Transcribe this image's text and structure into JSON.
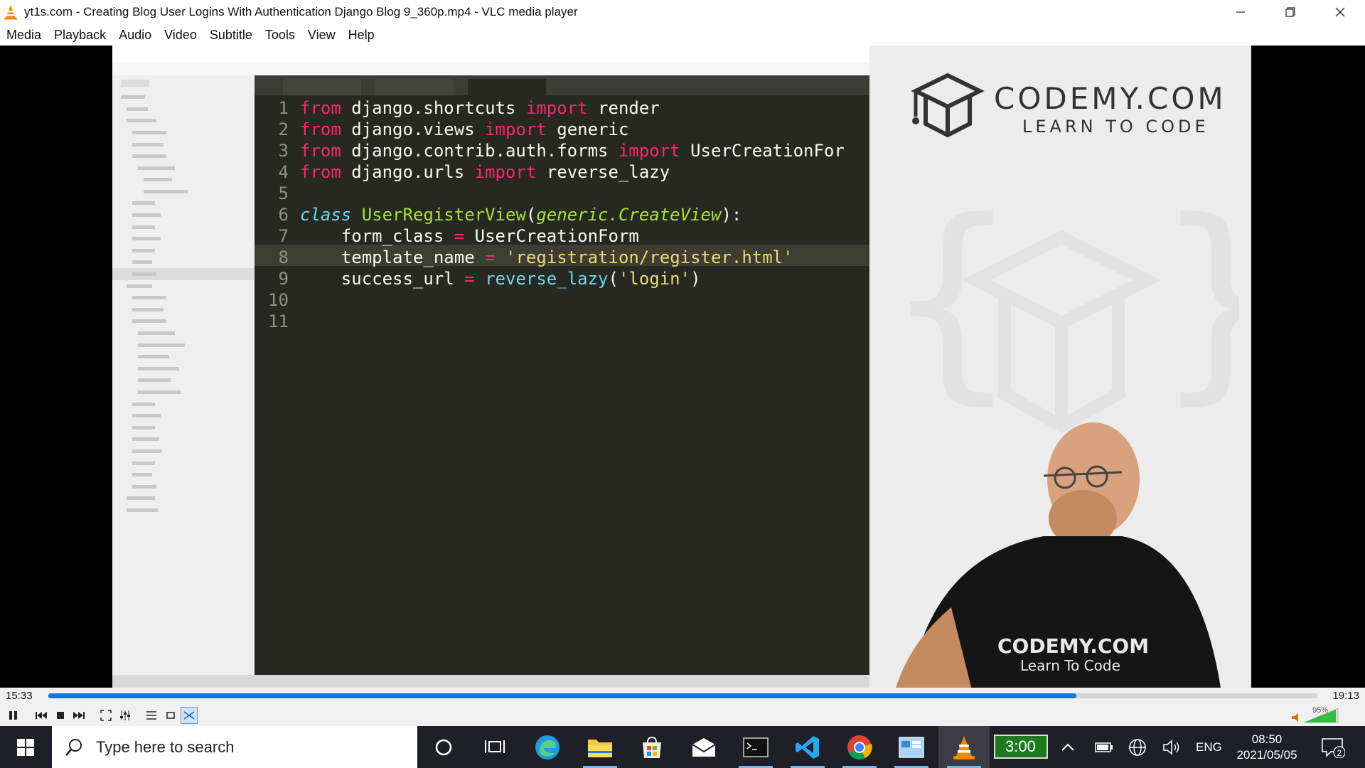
{
  "window": {
    "title": "yt1s.com - Creating Blog User Logins With Authentication  Django Blog 9_360p.mp4 - VLC media player"
  },
  "menu": [
    "Media",
    "Playback",
    "Audio",
    "Video",
    "Subtitle",
    "Tools",
    "View",
    "Help"
  ],
  "video": {
    "editor_lines": [
      [
        "1",
        "from django.shortcuts import render"
      ],
      [
        "2",
        "from django.views import generic"
      ],
      [
        "3",
        "from django.contrib.auth.forms import UserCreationFor"
      ],
      [
        "4",
        "from django.urls import reverse_lazy"
      ],
      [
        "5",
        ""
      ],
      [
        "6",
        "class UserRegisterView(generic.CreateView):"
      ],
      [
        "7",
        "    form_class = UserCreationForm"
      ],
      [
        "8",
        "    template_name = 'registration/register.html'"
      ],
      [
        "9",
        "    success_url = reverse_lazy('login')"
      ],
      [
        "10",
        ""
      ],
      [
        "11",
        ""
      ]
    ],
    "brand": {
      "name": "CODEMY.COM",
      "tagline": "LEARN TO CODE",
      "shirt_name": "CODEMY.COM",
      "shirt_tagline": "Learn To Code"
    }
  },
  "player": {
    "current_time": "15:33",
    "total_time": "19:13",
    "progress": 0.81,
    "volume": "95%"
  },
  "taskbar": {
    "search_placeholder": "Type here to search",
    "battery_label": "3:00",
    "language": "ENG",
    "time": "08:50",
    "date": "2021/05/05",
    "notifications": "2"
  }
}
